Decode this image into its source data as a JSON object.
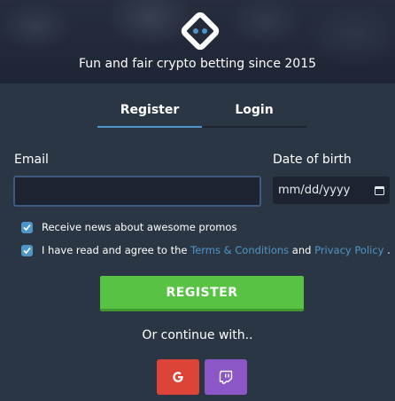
{
  "header": {
    "tagline": "Fun and fair crypto betting since 2015",
    "logo_icon": "diamond-logo-icon"
  },
  "tabs": [
    {
      "label": "Register",
      "active": true
    },
    {
      "label": "Login",
      "active": false
    }
  ],
  "form": {
    "email_label": "Email",
    "email_value": "",
    "dob_label": "Date of birth",
    "dob_placeholder": "mm/dd/yyyy",
    "promos_text": "Receive news about awesome promos",
    "promos_checked": true,
    "terms_prefix": "I have read and agree to the ",
    "terms_link": "Terms & Conditions",
    "terms_and": " and ",
    "privacy_link": "Privacy Policy",
    "terms_suffix": " .",
    "terms_checked": true,
    "register_label": "REGISTER"
  },
  "social": {
    "continue_text": "Or continue with..",
    "google_icon": "google-icon",
    "twitch_icon": "twitch-icon"
  },
  "colors": {
    "background": "#2b3644",
    "accent": "#4f96c8",
    "register": "#58c243",
    "google": "#db4437",
    "twitch": "#8b57c6"
  }
}
